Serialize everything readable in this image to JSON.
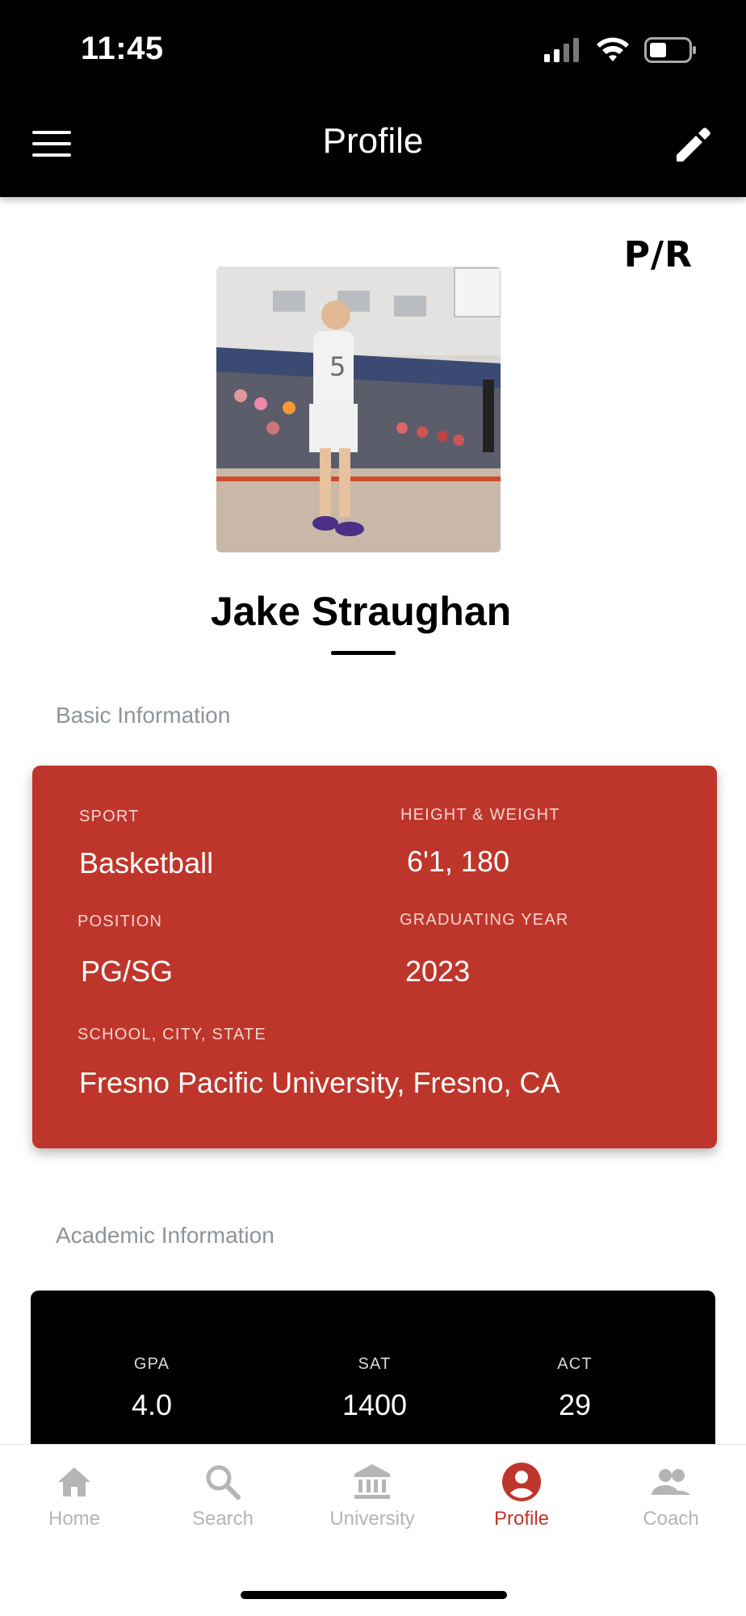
{
  "status_bar": {
    "time": "11:45"
  },
  "header": {
    "title": "Profile"
  },
  "brand": {
    "logo_text": "P/R"
  },
  "profile": {
    "name": "Jake Straughan",
    "jersey_number": "5"
  },
  "basic_info": {
    "section_label": "Basic Information",
    "sport_label": "SPORT",
    "sport_value": "Basketball",
    "height_weight_label": "HEIGHT & WEIGHT",
    "height_weight_value": "6'1, 180",
    "position_label": "POSITION",
    "position_value": "PG/SG",
    "grad_year_label": "GRADUATING YEAR",
    "grad_year_value": "2023",
    "school_label": "SCHOOL, CITY, STATE",
    "school_value": "Fresno Pacific University, Fresno, CA"
  },
  "academic_info": {
    "section_label": "Academic Information",
    "gpa_label": "GPA",
    "gpa_value": "4.0",
    "sat_label": "SAT",
    "sat_value": "1400",
    "act_label": "ACT",
    "act_value": "29"
  },
  "tabs": [
    {
      "label": "Home",
      "icon": "home-icon",
      "active": false
    },
    {
      "label": "Search",
      "icon": "search-icon",
      "active": false
    },
    {
      "label": "University",
      "icon": "university-icon",
      "active": false
    },
    {
      "label": "Profile",
      "icon": "profile-icon",
      "active": true
    },
    {
      "label": "Coach",
      "icon": "coach-icon",
      "active": false
    }
  ],
  "colors": {
    "accent": "#be362b",
    "header_bg": "#000000",
    "inactive_tab": "#b5b5b5"
  }
}
